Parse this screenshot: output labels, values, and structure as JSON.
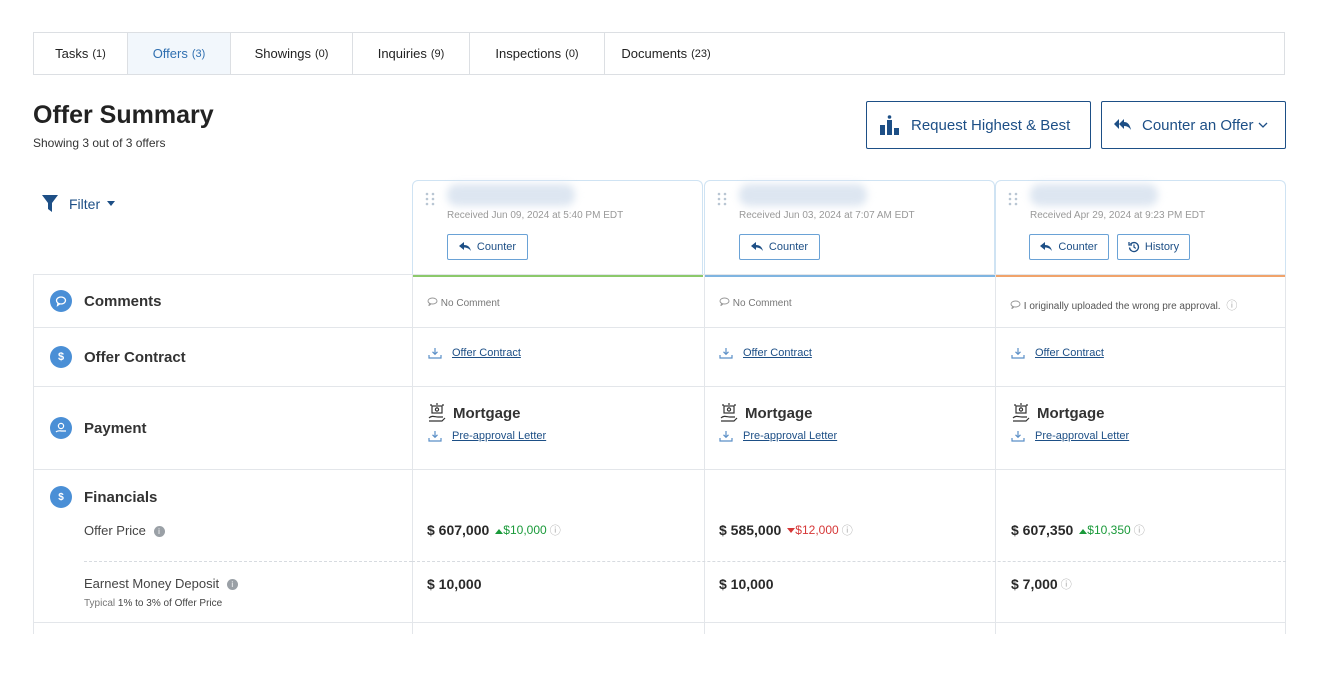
{
  "tabs": [
    {
      "label": "Tasks",
      "count": "(1)"
    },
    {
      "label": "Offers",
      "count": "(3)"
    },
    {
      "label": "Showings",
      "count": "(0)"
    },
    {
      "label": "Inquiries",
      "count": "(9)"
    },
    {
      "label": "Inspections",
      "count": "(0)"
    },
    {
      "label": "Documents",
      "count": "(23)"
    }
  ],
  "active_tab": "Offers",
  "header": {
    "title": "Offer Summary",
    "subtitle": "Showing 3 out of 3 offers",
    "request_button": "Request Highest & Best",
    "counter_button": "Counter an Offer"
  },
  "filter_label": "Filter",
  "offers": [
    {
      "received": "Received Jun 09, 2024 at 5:40 PM EDT",
      "counter_label": "Counter",
      "accent": "#8cc96b"
    },
    {
      "received": "Received Jun 03, 2024 at 7:07 AM EDT",
      "counter_label": "Counter",
      "accent": "#7fb4e0"
    },
    {
      "received": "Received Apr 29, 2024 at 9:23 PM EDT",
      "counter_label": "Counter",
      "history_label": "History",
      "accent": "#f0a36b"
    }
  ],
  "rows": {
    "comments": "Comments",
    "offer_contract": "Offer Contract",
    "payment": "Payment",
    "financials": "Financials",
    "offer_price": "Offer Price",
    "earnest_money": "Earnest Money Deposit",
    "typical_prefix": "Typical",
    "typical_value": "1% to 3% of Offer Price"
  },
  "comments": [
    "No Comment",
    "No Comment",
    "I originally uploaded the wrong pre approval."
  ],
  "contract_link": "Offer Contract",
  "payment_type": "Mortgage",
  "preapproval_link": "Pre-approval Letter",
  "prices": [
    {
      "value": "$ 607,000",
      "delta": "$10,000",
      "dir": "up"
    },
    {
      "value": "$ 585,000",
      "delta": "$12,000",
      "dir": "down"
    },
    {
      "value": "$ 607,350",
      "delta": "$10,350",
      "dir": "up"
    }
  ],
  "deposits": [
    "$ 10,000",
    "$ 10,000",
    "$ 7,000"
  ],
  "colors": {
    "brand": "#1d4f86",
    "icon_blue": "#4a8fd6",
    "up": "#1a9a3a",
    "down": "#d63838"
  }
}
